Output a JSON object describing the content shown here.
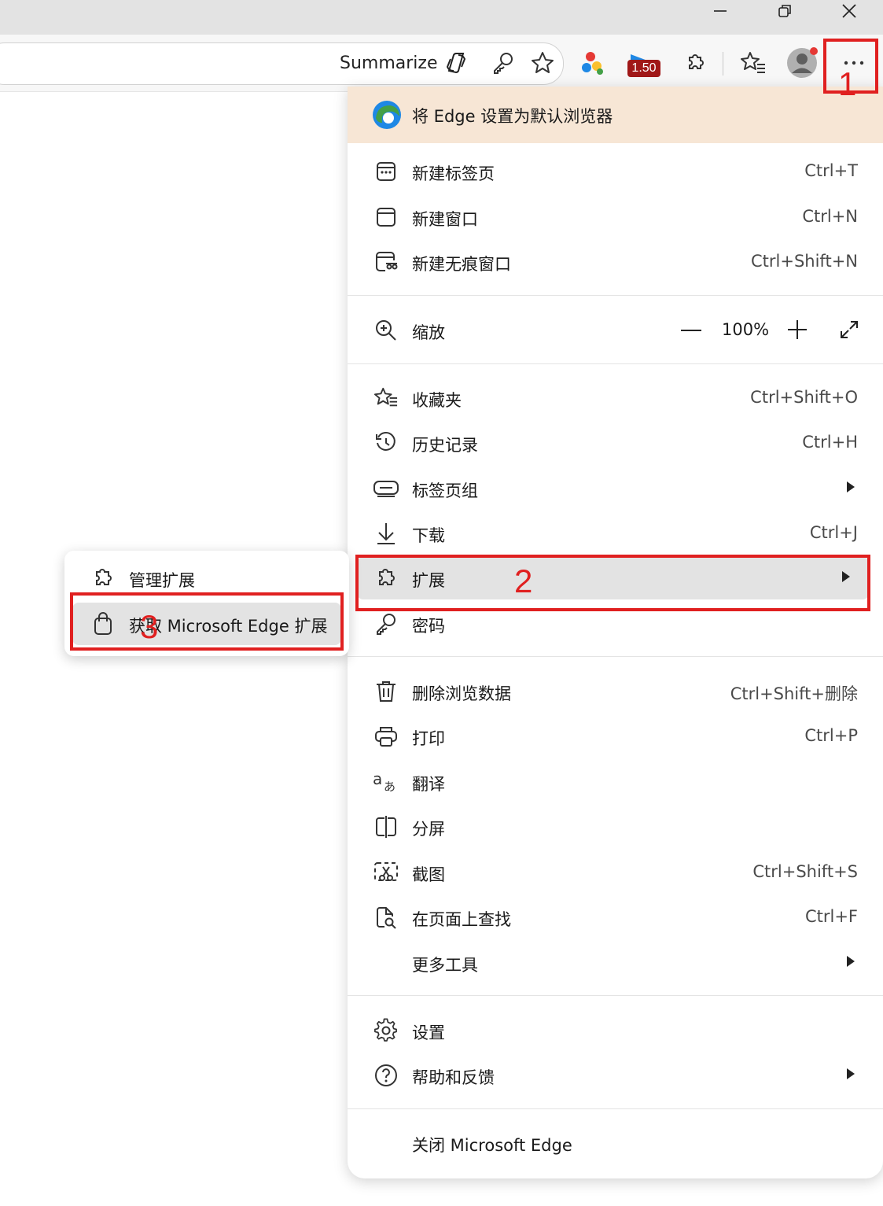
{
  "toolbar": {
    "summarize_label": "Summarize",
    "extension_badge": "1.50",
    "icons": [
      "copilot-icon",
      "key-icon",
      "favorite-star-icon",
      "extension-colorful-icon",
      "extension-ticket-icon",
      "extensions-puzzle-icon",
      "favorites-list-icon",
      "profile-avatar-icon",
      "more-dots-icon"
    ]
  },
  "window_controls": [
    "minimize-icon",
    "restore-icon",
    "close-icon"
  ],
  "annotations": {
    "a1": "1",
    "a2": "2",
    "a3": "3"
  },
  "accent_colors": {
    "annotation_red": "#e02020",
    "banner_bg": "#f7e6d5",
    "highlight_bg": "#e3e3e3"
  },
  "menu": {
    "banner": "将 Edge 设置为默认浏览器",
    "group1": [
      {
        "label": "新建标签页",
        "shortcut": "Ctrl+T",
        "icon": "new-tab-icon"
      },
      {
        "label": "新建窗口",
        "shortcut": "Ctrl+N",
        "icon": "new-window-icon"
      },
      {
        "label": "新建无痕窗口",
        "shortcut": "Ctrl+Shift+N",
        "icon": "inprivate-window-icon"
      }
    ],
    "zoom": {
      "label": "缩放",
      "value": "100%"
    },
    "group2": [
      {
        "label": "收藏夹",
        "shortcut": "Ctrl+Shift+O",
        "icon": "favorites-icon"
      },
      {
        "label": "历史记录",
        "shortcut": "Ctrl+H",
        "icon": "history-icon"
      },
      {
        "label": "标签页组",
        "shortcut": "",
        "icon": "tab-groups-icon"
      },
      {
        "label": "下载",
        "shortcut": "Ctrl+J",
        "icon": "download-icon"
      },
      {
        "label": "扩展",
        "shortcut": "",
        "icon": "extensions-icon"
      },
      {
        "label": "密码",
        "shortcut": "",
        "icon": "password-icon"
      }
    ],
    "group3": [
      {
        "label": "删除浏览数据",
        "shortcut": "Ctrl+Shift+删除",
        "icon": "trash-icon"
      },
      {
        "label": "打印",
        "shortcut": "Ctrl+P",
        "icon": "print-icon"
      },
      {
        "label": "翻译",
        "shortcut": "",
        "icon": "translate-icon"
      },
      {
        "label": "分屏",
        "shortcut": "",
        "icon": "split-screen-icon"
      },
      {
        "label": "截图",
        "shortcut": "Ctrl+Shift+S",
        "icon": "screenshot-icon"
      },
      {
        "label": "在页面上查找",
        "shortcut": "Ctrl+F",
        "icon": "find-on-page-icon"
      },
      {
        "label": "更多工具",
        "shortcut": "",
        "icon": ""
      }
    ],
    "group4": [
      {
        "label": "设置",
        "icon": "settings-gear-icon"
      },
      {
        "label": "帮助和反馈",
        "icon": "help-icon"
      }
    ],
    "close_label": "关闭 Microsoft Edge"
  },
  "submenu": {
    "manage": "管理扩展",
    "get": "获取 Microsoft Edge 扩展"
  }
}
